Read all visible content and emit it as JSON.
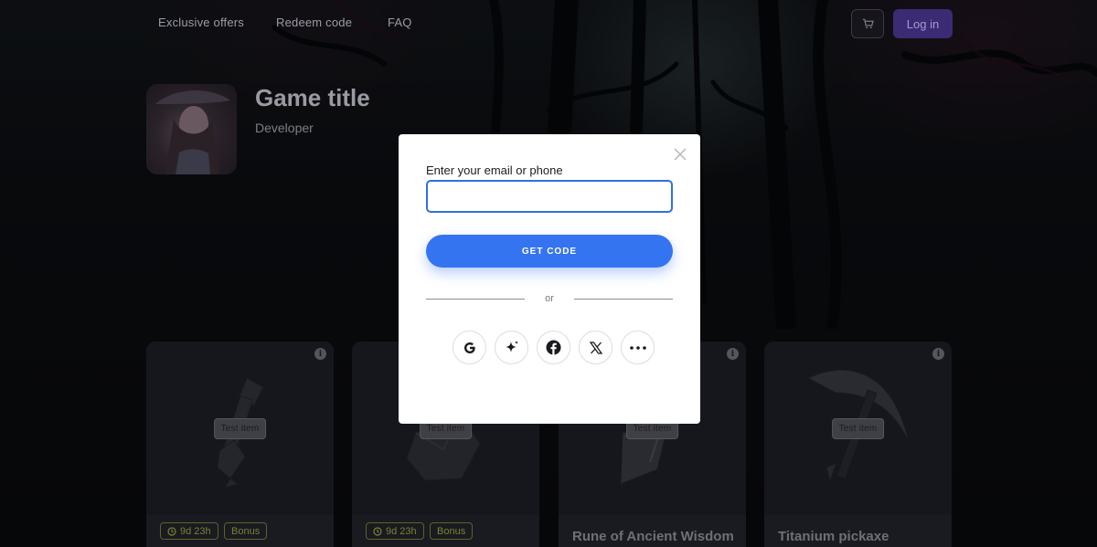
{
  "nav": {
    "links": [
      "Exclusive offers",
      "Redeem code",
      "FAQ"
    ],
    "login_label": "Log in"
  },
  "game": {
    "title": "Game title",
    "developer": "Developer"
  },
  "cards": [
    {
      "tag": "Test item",
      "timer": "9d 23h",
      "bonus": "Bonus",
      "name": ""
    },
    {
      "tag": "Test item",
      "timer": "9d 23h",
      "bonus": "Bonus",
      "name": ""
    },
    {
      "tag": "Test item",
      "timer": "",
      "bonus": "",
      "name": "Rune of Ancient Wisdom"
    },
    {
      "tag": "Test item",
      "timer": "",
      "bonus": "",
      "name": "Titanium pickaxe"
    }
  ],
  "modal": {
    "field_label": "Enter your email or phone",
    "field_value": "",
    "submit_label": "GET CODE",
    "divider_text": "or",
    "social_icons": [
      "google-icon",
      "sparkle-icon",
      "facebook-icon",
      "x-icon",
      "more-icon"
    ]
  },
  "colors": {
    "primary": "#3574f0",
    "login_bg": "#3b2a74",
    "bonus_chip": "#7c8035"
  }
}
